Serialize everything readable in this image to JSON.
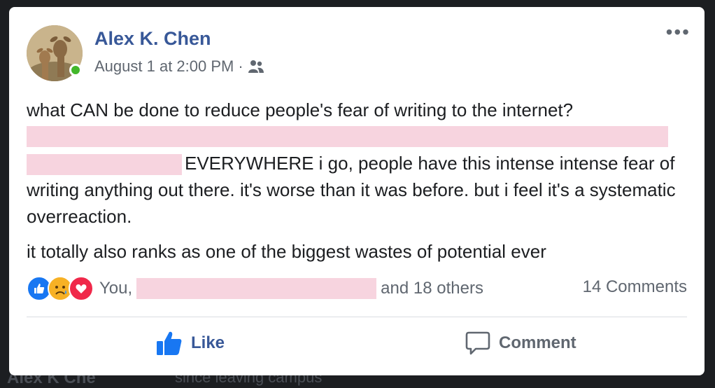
{
  "background": {
    "bottom_left_text": "Alex K Che",
    "bottom_center_text": "since leaving campus"
  },
  "post": {
    "author": "Alex K. Chen",
    "timestamp": "August 1 at 2:00 PM",
    "separator": "·",
    "audience_icon": "friends-icon",
    "more_label": "•••",
    "paragraph1_line1": "what CAN be done to reduce people's fear of writing to the internet?",
    "paragraph1_text": "EVERYWHERE i go, people have this intense intense fear of writing anything out there. it's worse than it was before. but i feel it's a systematic overreaction.",
    "paragraph2": "it totally also ranks as one of the biggest wastes of potential ever"
  },
  "reactions": {
    "icons": [
      "like-reaction-icon",
      "sad-reaction-icon",
      "love-reaction-icon"
    ],
    "prefix": "You,",
    "suffix": "and 18 others",
    "comments": "14 Comments"
  },
  "actions": {
    "like": "Like",
    "comment": "Comment"
  },
  "colors": {
    "author": "#385898",
    "online": "#42b72a",
    "redaction": "#f7d4df",
    "like": "#385898"
  }
}
